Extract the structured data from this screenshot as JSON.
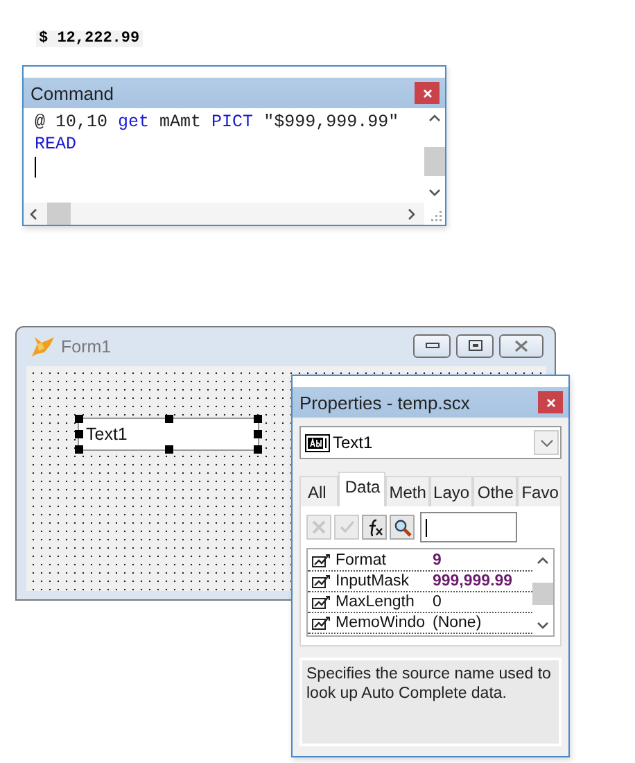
{
  "output": {
    "text": "$ 12,222.99"
  },
  "command_window": {
    "title": "Command",
    "lines": [
      [
        {
          "text": "@ 10,10 ",
          "kind": "plain"
        },
        {
          "text": "get",
          "kind": "keyword"
        },
        {
          "text": " mAmt ",
          "kind": "plain"
        },
        {
          "text": "PICT",
          "kind": "keyword"
        },
        {
          "text": " \"$999,999.99\"",
          "kind": "plain"
        }
      ],
      [
        {
          "text": "READ",
          "kind": "keyword"
        }
      ]
    ]
  },
  "form_window": {
    "title": "Form1",
    "textbox": {
      "text": "Text1",
      "selected": true
    }
  },
  "properties_window": {
    "title": "Properties - temp.scx",
    "object": "Text1",
    "tabs": [
      {
        "label": "All",
        "selected": false
      },
      {
        "label": "Data",
        "selected": true
      },
      {
        "label": "Meth",
        "selected": false
      },
      {
        "label": "Layo",
        "selected": false
      },
      {
        "label": "Othe",
        "selected": false
      },
      {
        "label": "Favo",
        "selected": false
      }
    ],
    "tools": [
      {
        "kind": "cancel",
        "disabled": true
      },
      {
        "kind": "accept",
        "disabled": true
      },
      {
        "kind": "function",
        "disabled": false
      },
      {
        "kind": "zoom",
        "disabled": false
      }
    ],
    "rows": [
      {
        "name": "Format",
        "value": "9",
        "modified": true
      },
      {
        "name": "InputMask",
        "value": "999,999.99",
        "modified": true
      },
      {
        "name": "MaxLength",
        "value": "0",
        "modified": false
      },
      {
        "name": "MemoWindo",
        "value": "(None)",
        "modified": false
      }
    ],
    "description": "Specifies the source name used to look up Auto Complete data."
  }
}
